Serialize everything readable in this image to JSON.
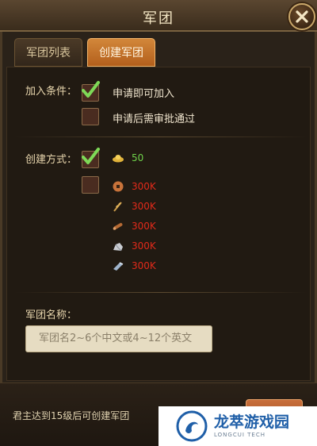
{
  "window": {
    "title": "军团"
  },
  "tabs": [
    {
      "label": "军团列表"
    },
    {
      "label": "创建军团"
    }
  ],
  "join_conditions": {
    "label": "加入条件：",
    "options": [
      {
        "label": "申请即可加入",
        "checked": true
      },
      {
        "label": "申请后需审批通过",
        "checked": false
      }
    ]
  },
  "create_method": {
    "label": "创建方式：",
    "options": [
      {
        "checked": true,
        "costs": [
          {
            "icon": "gold-ingot-icon",
            "value": "50",
            "color": "#6fd24a"
          }
        ]
      },
      {
        "checked": false,
        "costs": [
          {
            "icon": "copper-coin-icon",
            "value": "300K",
            "color": "#e12a1a"
          },
          {
            "icon": "grain-icon",
            "value": "300K",
            "color": "#e12a1a"
          },
          {
            "icon": "wood-icon",
            "value": "300K",
            "color": "#e12a1a"
          },
          {
            "icon": "stone-icon",
            "value": "300K",
            "color": "#e12a1a"
          },
          {
            "icon": "iron-icon",
            "value": "300K",
            "color": "#e12a1a"
          }
        ]
      }
    ]
  },
  "legion_name": {
    "label": "军团名称：",
    "placeholder": "军团名2~6个中文或4~12个英文"
  },
  "footer": {
    "notice": "君主达到15级后可创建军团"
  },
  "watermark": {
    "title": "龙萃游戏园",
    "subtitle": "LONGCUI TECH"
  },
  "colors": {
    "accent": "#c86e3a",
    "check": "#7ed957",
    "cost_red": "#e12a1a",
    "cost_green": "#6fd24a"
  }
}
